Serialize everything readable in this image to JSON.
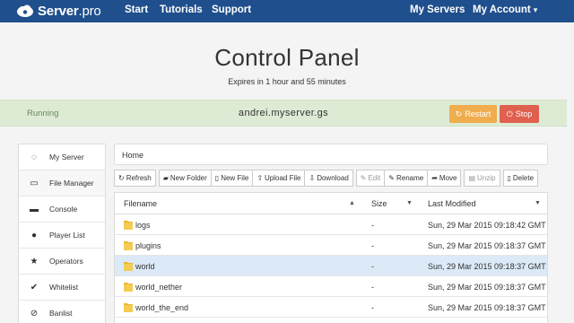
{
  "navbar": {
    "brand_name": "Server",
    "brand_suffix": ".pro",
    "links": [
      "Start",
      "Tutorials",
      "Support"
    ],
    "my_servers": "My Servers",
    "my_account": "My Account",
    "caret_icon": "chevron-down-icon"
  },
  "header": {
    "title": "Control Panel",
    "subtitle": "Expires in 1 hour and 55 minutes"
  },
  "status": {
    "state": "Running",
    "server_name": "andrei.myserver.gs",
    "restart_label": "Restart",
    "stop_label": "Stop",
    "restart_color": "#f0ad4e",
    "stop_color": "#e0604f"
  },
  "sidebar": {
    "items": [
      {
        "label": "My Server",
        "icon": "power-icon",
        "glyph": "◌"
      },
      {
        "label": "File Manager",
        "icon": "file-icon",
        "glyph": "▭"
      },
      {
        "label": "Console",
        "icon": "terminal-icon",
        "glyph": "▬"
      },
      {
        "label": "Player List",
        "icon": "user-icon",
        "glyph": "●"
      },
      {
        "label": "Operators",
        "icon": "star-icon",
        "glyph": "★"
      },
      {
        "label": "Whitelist",
        "icon": "check-icon",
        "glyph": "✔"
      },
      {
        "label": "Banlist",
        "icon": "ban-icon",
        "glyph": "⊘"
      }
    ]
  },
  "file_manager": {
    "breadcrumb": "Home",
    "toolbar": [
      {
        "label": "Refresh",
        "icon": "refresh-icon",
        "glyph": "↻",
        "enabled": true
      },
      {
        "label": "New Folder",
        "icon": "folder-plus-icon",
        "glyph": "▰",
        "enabled": true
      },
      {
        "label": "New File",
        "icon": "file-plus-icon",
        "glyph": "▯",
        "enabled": true
      },
      {
        "label": "Upload File",
        "icon": "upload-icon",
        "glyph": "⇧",
        "enabled": true
      },
      {
        "label": "Download",
        "icon": "download-icon",
        "glyph": "⇩",
        "enabled": true
      },
      {
        "label": "Edit",
        "icon": "pencil-icon",
        "glyph": "✎",
        "enabled": false
      },
      {
        "label": "Rename",
        "icon": "rename-icon",
        "glyph": "✎",
        "enabled": true
      },
      {
        "label": "Move",
        "icon": "move-icon",
        "glyph": "➦",
        "enabled": true
      },
      {
        "label": "Unzip",
        "icon": "archive-icon",
        "glyph": "▤",
        "enabled": false
      },
      {
        "label": "Delete",
        "icon": "trash-icon",
        "glyph": "▯",
        "enabled": true
      }
    ],
    "columns": {
      "filename": "Filename",
      "size": "Size",
      "last_modified": "Last Modified"
    },
    "rows": [
      {
        "name": "logs",
        "size": "-",
        "modified": "Sun, 29 Mar 2015 09:18:42 GMT",
        "selected": false
      },
      {
        "name": "plugins",
        "size": "-",
        "modified": "Sun, 29 Mar 2015 09:18:37 GMT",
        "selected": false
      },
      {
        "name": "world",
        "size": "-",
        "modified": "Sun, 29 Mar 2015 09:18:37 GMT",
        "selected": true
      },
      {
        "name": "world_nether",
        "size": "-",
        "modified": "Sun, 29 Mar 2015 09:18:37 GMT",
        "selected": false
      },
      {
        "name": "world_the_end",
        "size": "-",
        "modified": "Sun, 29 Mar 2015 09:18:37 GMT",
        "selected": false
      }
    ]
  }
}
